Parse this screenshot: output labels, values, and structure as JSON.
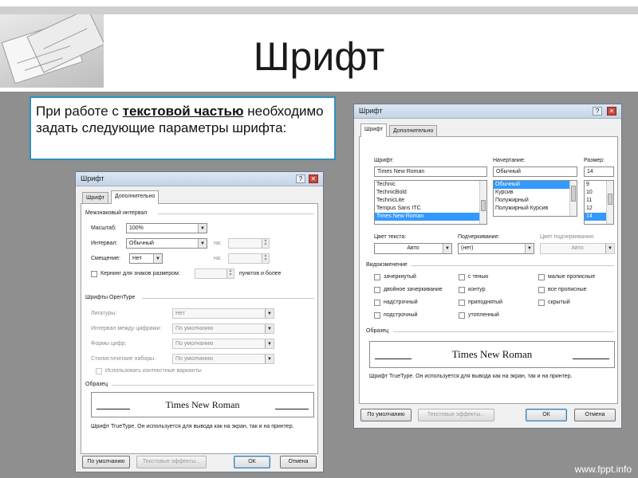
{
  "slide": {
    "title": "Шрифт",
    "note_pre": "При работе с ",
    "note_bold": "текстовой частью",
    "note_post": " необходимо задать следующие параметры шрифта:",
    "footer": "www.fppt.info"
  },
  "left_dialog": {
    "title": "Шрифт",
    "tabs": [
      "Шрифт",
      "Дополнительно"
    ],
    "spacing_group": "Межзнаковый интервал",
    "scale_label": "Масштаб:",
    "scale_value": "100%",
    "interval_label": "Интервал:",
    "interval_value": "Обычный",
    "interval_on": "на:",
    "offset_label": "Смещение:",
    "offset_value": "Нет",
    "offset_on": "на:",
    "kerning_label": "Кернинг для знаков размером:",
    "kerning_suffix": "пунктов и более",
    "opentype_group": "Шрифты OpenType",
    "ligatures_label": "Лигатуры:",
    "ligatures_value": "Нет",
    "numspacing_label": "Интервал между цифрами:",
    "numspacing_value": "По умолчанию",
    "numforms_label": "Формы цифр:",
    "numforms_value": "По умолчанию",
    "stylistic_label": "Стилистические наборы:",
    "stylistic_value": "По умолчанию",
    "contextual_label": "Использовать контекстные варианты",
    "sample_group": "Образец",
    "sample_text": "Times New Roman",
    "description": "Шрифт TrueType. Он используется для вывода как на экран, так и на принтер.",
    "btn_default": "По умолчанию",
    "btn_effects": "Текстовые эффекты...",
    "btn_ok": "ОК",
    "btn_cancel": "Отмена"
  },
  "right_dialog": {
    "title": "Шрифт",
    "tabs": [
      "Шрифт",
      "Дополнительно"
    ],
    "font_label": "Шрифт:",
    "font_value": "Times New Roman",
    "font_list": [
      "Technic",
      "TechnicBold",
      "TechnicLite",
      "Tempus Sans ITC",
      "Times New Roman"
    ],
    "font_selected": "Times New Roman",
    "style_label": "Начертание:",
    "style_value": "Обычный",
    "style_list": [
      "Обычный",
      "Курсив",
      "Полужирный",
      "Полужирный Курсив"
    ],
    "style_selected": "Обычный",
    "size_label": "Размер:",
    "size_value": "14",
    "size_list": [
      "9",
      "10",
      "11",
      "12",
      "14"
    ],
    "size_selected": "14",
    "color_label": "Цвет текста:",
    "color_value": "Авто",
    "underline_label": "Подчеркивание:",
    "underline_value": "(нет)",
    "underline_color_label": "Цвет подчеркивания:",
    "underline_color_value": "Авто",
    "effects_group": "Видоизменение",
    "effects_col1": [
      "зачеркнутый",
      "двойное зачеркивание",
      "надстрочный",
      "подстрочный"
    ],
    "effects_col2": [
      "с тенью",
      "контур",
      "приподнятый",
      "утопленный"
    ],
    "effects_col3": [
      "малые прописные",
      "все прописные",
      "скрытый"
    ],
    "sample_group": "Образец",
    "sample_text": "Times New Roman",
    "description": "Шрифт TrueType. Он используется для вывода как на экран, так и на принтер.",
    "btn_default": "По умолчанию",
    "btn_effects": "Текстовые эффекты...",
    "btn_ok": "ОК",
    "btn_cancel": "Отмена"
  },
  "colors": {
    "accent_border": "#2f8fbf",
    "selection": "#3399ff",
    "close_button": "#c9473b"
  },
  "icons": [
    "help-icon",
    "close-icon",
    "dropdown-arrow-icon"
  ]
}
